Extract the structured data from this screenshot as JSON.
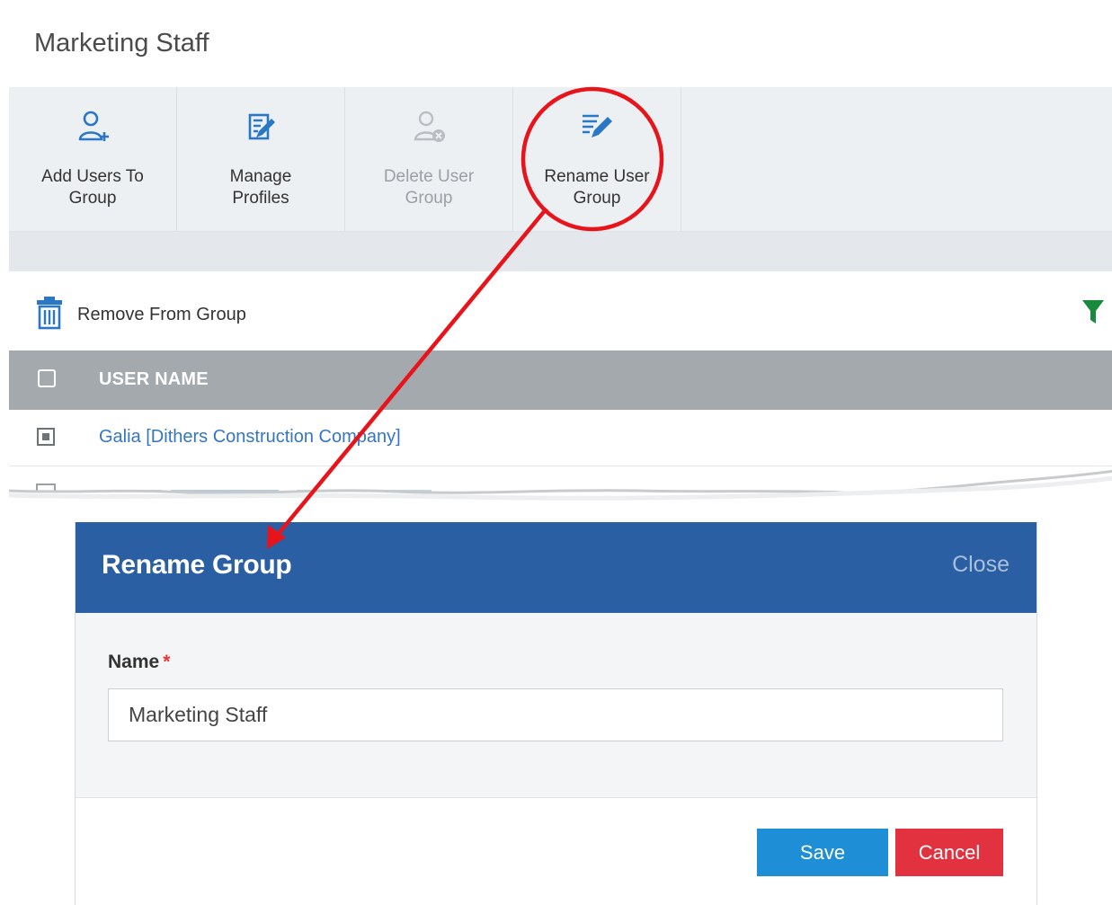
{
  "page": {
    "title": "Marketing Staff"
  },
  "toolbar": {
    "buttons": [
      {
        "label_line1": "Add Users To",
        "label_line2": "Group",
        "icon": "add-user-icon",
        "enabled": true
      },
      {
        "label_line1": "Manage",
        "label_line2": "Profiles",
        "icon": "manage-profiles-icon",
        "enabled": true
      },
      {
        "label_line1": "Delete User",
        "label_line2": "Group",
        "icon": "delete-user-group-icon",
        "enabled": false
      },
      {
        "label_line1": "Rename User",
        "label_line2": "Group",
        "icon": "rename-group-icon",
        "enabled": true
      }
    ]
  },
  "actions": {
    "remove_label": "Remove From Group",
    "remove_icon": "trash-icon",
    "filter_icon": "filter-icon"
  },
  "table": {
    "header": {
      "user_name": "USER NAME"
    },
    "rows": [
      {
        "name": "Galia [Dithers Construction Company]"
      }
    ]
  },
  "modal": {
    "title": "Rename Group",
    "close_label": "Close",
    "field_label": "Name",
    "required_mark": "*",
    "name_value": "Marketing Staff",
    "save_label": "Save",
    "cancel_label": "Cancel"
  },
  "colors": {
    "icon_blue": "#2a78c5",
    "header_blue": "#2b5fa3",
    "table_header_gray": "#a4a9ad",
    "link_blue": "#3576c4",
    "save_button": "#1e8fd6",
    "cancel_button": "#e2323f",
    "annotation_red": "#e8141b",
    "filter_green": "#178a3c"
  }
}
